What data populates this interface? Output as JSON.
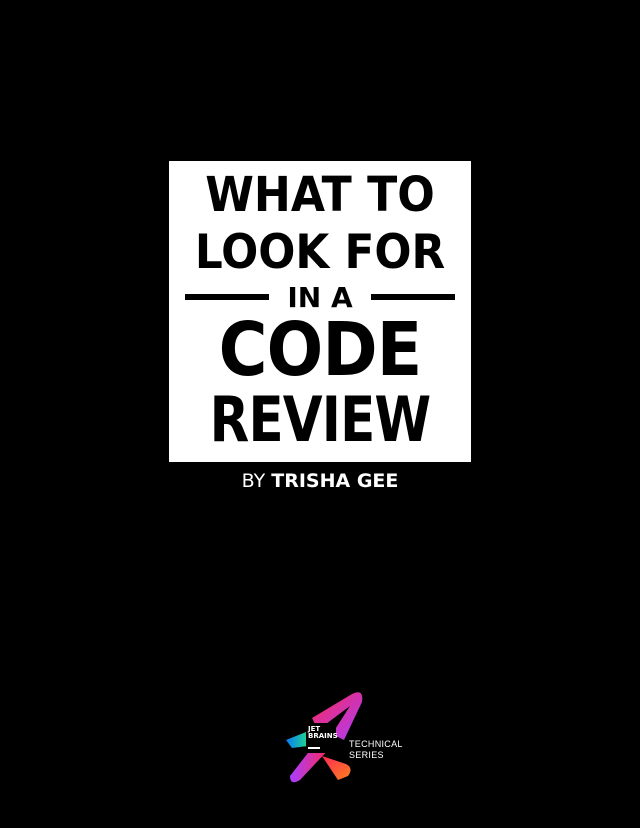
{
  "cover": {
    "title_line1": "WHAT TO",
    "title_line2": "LOOK FOR",
    "title_line3": "IN A",
    "title_line4": "CODE",
    "title_line5": "REVIEW",
    "by_label": "BY",
    "author": "TRISHA GEE"
  },
  "logo": {
    "name_line1": "JET",
    "name_line2": "BRAINS",
    "series_line1": "TECHNICAL",
    "series_line2": "SERIES",
    "colors": [
      "#fe2857",
      "#fc801d",
      "#21d789",
      "#087cfa",
      "#a93dff"
    ]
  },
  "colors": {
    "background": "#000000",
    "title_box": "#ffffff",
    "title_text": "#000000",
    "byline_text": "#ffffff"
  }
}
